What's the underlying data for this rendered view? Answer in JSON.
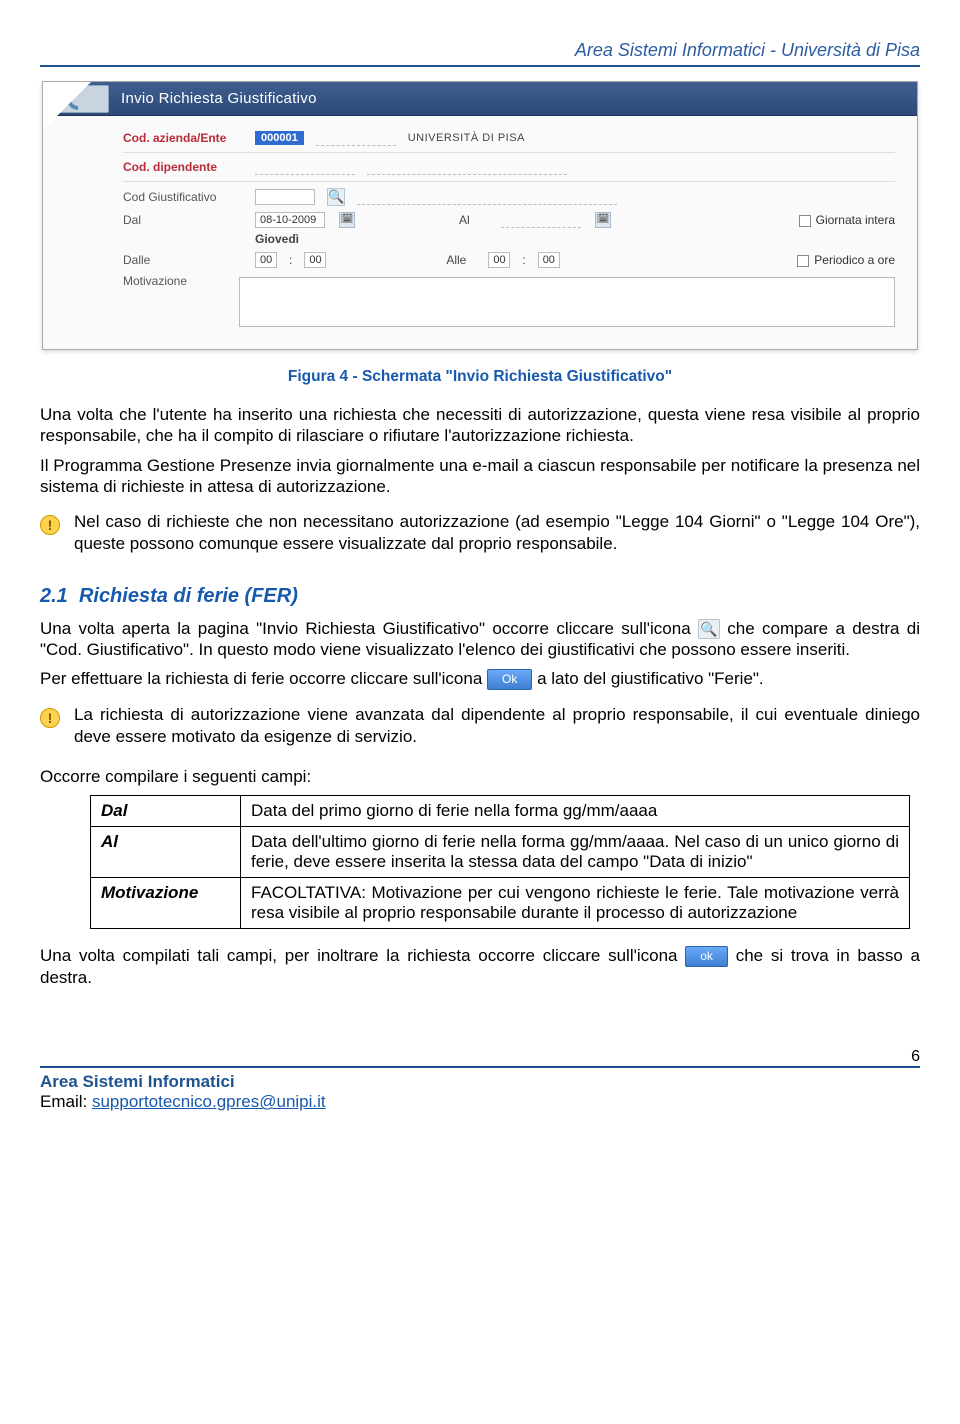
{
  "header": {
    "right": "Area Sistemi Informatici  - Università di Pisa"
  },
  "screenshot": {
    "title": "Invio Richiesta Giustificativo",
    "labels": {
      "cod_azienda": "Cod. azienda/Ente",
      "cod_dipendente": "Cod. dipendente",
      "cod_giustificativo": "Cod Giustificativo",
      "dal": "Dal",
      "al": "Al",
      "dalle": "Dalle",
      "alle": "Alle",
      "motivazione": "Motivazione"
    },
    "values": {
      "cod_azienda": "000001",
      "ente": "UNIVERSITÀ DI PISA",
      "dal_date": "08-10-2009",
      "dal_day": "Giovedì",
      "dalle_h": "00",
      "dalle_m": "00",
      "alle_h": "00",
      "alle_m": "00"
    },
    "checkboxes": {
      "giornata_intera": "Giornata intera",
      "periodico_ore": "Periodico a ore"
    }
  },
  "caption": "Figura 4 - Schermata \"Invio Richiesta Giustificativo\"",
  "para1": "Una volta che l'utente ha inserito una richiesta che necessiti di autorizzazione, questa viene resa visibile al proprio responsabile, che ha il compito di rilasciare o rifiutare l'autorizzazione richiesta.",
  "para2": "Il Programma Gestione Presenze invia giornalmente una e-mail a ciascun responsabile per notificare la presenza nel sistema di richieste in attesa di autorizzazione.",
  "alert1": "Nel caso di richieste che non necessitano autorizzazione (ad esempio \"Legge 104 Giorni\" o \"Legge 104 Ore\"), queste possono comunque essere visualizzate dal proprio responsabile.",
  "section": {
    "number": "2.1",
    "title": "Richiesta di ferie (FER)"
  },
  "para_sec1_a": "Una volta aperta la pagina \"Invio Richiesta Giustificativo\" occorre cliccare sull'icona ",
  "para_sec1_b": " che compare a destra di \"Cod. Giustificativo\". In questo modo viene visualizzato l'elenco dei giustificativi che possono essere inseriti.",
  "para_sec2_a": "Per effettuare la richiesta di ferie occorre cliccare sull'icona ",
  "para_sec2_b": " a lato del giustificativo \"Ferie\".",
  "ok_label": "Ok",
  "ok_label_lc": "ok",
  "alert2": "La richiesta di autorizzazione viene avanzata dal dipendente al proprio responsabile,  il cui eventuale diniego deve essere motivato da esigenze di servizio.",
  "para_fields_intro": "Occorre compilare i seguenti campi:",
  "fields": {
    "dal": {
      "label": "Dal",
      "desc": "Data del primo giorno di ferie nella forma gg/mm/aaaa"
    },
    "al": {
      "label": "Al",
      "desc": "Data dell'ultimo giorno di ferie nella forma gg/mm/aaaa. Nel caso di un unico giorno di ferie, deve essere inserita la stessa data del campo \"Data di inizio\""
    },
    "motiv": {
      "label": "Motivazione",
      "desc": "FACOLTATIVA: Motivazione per cui vengono richieste le ferie. Tale motivazione verrà resa visibile al proprio responsabile durante il processo di autorizzazione"
    }
  },
  "para_final_a": "Una volta compilati tali campi, per inoltrare la richiesta occorre cliccare sull'icona ",
  "para_final_b": " che si trova in basso a destra.",
  "footer": {
    "org": "Area Sistemi Informatici",
    "email_label": "Email: ",
    "email": "supportotecnico.gpres@unipi.it",
    "page_number": "6"
  }
}
